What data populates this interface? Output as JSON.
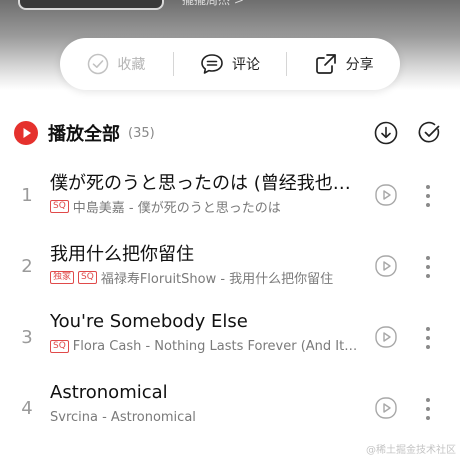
{
  "hero": {
    "artist_peek": "擺擺周杰 >"
  },
  "actions": {
    "collect_label": "收藏",
    "comment_label": "评论",
    "share_label": "分享"
  },
  "list_header": {
    "play_all_label": "播放全部",
    "count": "(35)"
  },
  "tracks": [
    {
      "index": "1",
      "title": "僕が死のうと思ったのは (曾经我也想过一了百了)",
      "badges": [
        "SQ"
      ],
      "subtitle": "中島美嘉 - 僕が死のうと思ったのは"
    },
    {
      "index": "2",
      "title": "我用什么把你留住",
      "badges": [
        "独家",
        "SQ"
      ],
      "subtitle": "福禄寿FloruitShow - 我用什么把你留住"
    },
    {
      "index": "3",
      "title": "You're Somebody Else",
      "badges": [
        "SQ"
      ],
      "subtitle": "Flora Cash - Nothing Lasts Forever (And It's Fine)"
    },
    {
      "index": "4",
      "title": "Astronomical",
      "badges": [],
      "subtitle": "Svrcina - Astronomical"
    }
  ],
  "watermark": "@稀土掘金技术社区",
  "colors": {
    "accent": "#e5312d",
    "badge": "#e04a4a",
    "muted": "#9a9a9a"
  }
}
